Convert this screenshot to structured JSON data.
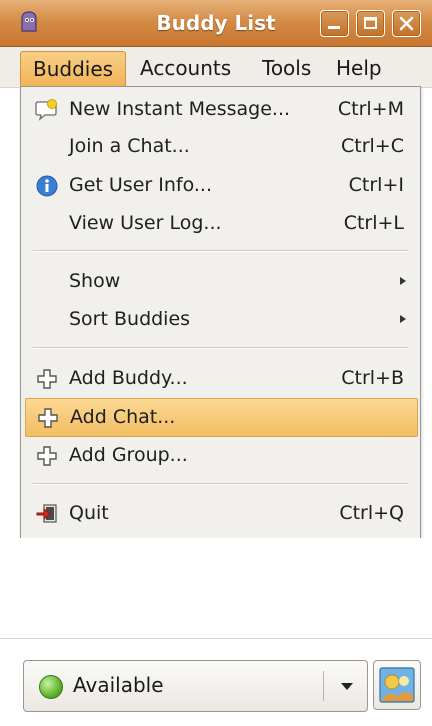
{
  "window": {
    "title": "Buddy List",
    "app_icon": "pidgin-icon",
    "controls": [
      "minimize-icon",
      "maximize-icon",
      "close-icon"
    ]
  },
  "menubar": {
    "items": [
      {
        "label": "Buddies",
        "active": true
      },
      {
        "label": "Accounts"
      },
      {
        "label": "Tools"
      },
      {
        "label": "Help"
      }
    ]
  },
  "buddies_menu": {
    "items": [
      {
        "label": "New Instant Message...",
        "accel": "Ctrl+M",
        "icon": "new-message-icon"
      },
      {
        "label": "Join a Chat...",
        "accel": "Ctrl+C"
      },
      {
        "label": "Get User Info...",
        "accel": "Ctrl+I",
        "icon": "info-icon"
      },
      {
        "label": "View User Log...",
        "accel": "Ctrl+L"
      },
      {
        "label": "Show",
        "submenu": true
      },
      {
        "label": "Sort Buddies",
        "submenu": true
      },
      {
        "label": "Add Buddy...",
        "accel": "Ctrl+B",
        "icon": "add-icon"
      },
      {
        "label": "Add Chat...",
        "icon": "add-icon",
        "highlighted": true
      },
      {
        "label": "Add Group...",
        "icon": "add-icon"
      },
      {
        "label": "Quit",
        "accel": "Ctrl+Q",
        "icon": "quit-icon"
      }
    ]
  },
  "status": {
    "label": "Available",
    "indicator_color": "#5fb32c"
  },
  "colors": {
    "titlebar": "#d58c46",
    "highlight": "#f3bd62",
    "menu_bg": "#f2f0ec"
  }
}
